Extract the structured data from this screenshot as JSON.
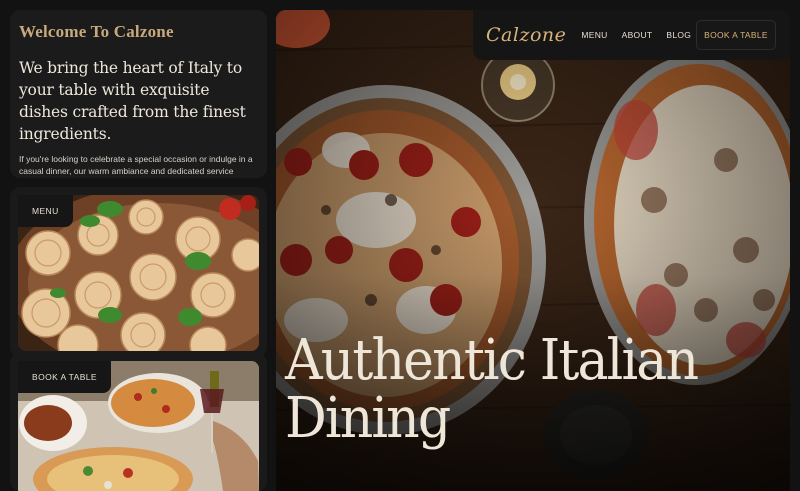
{
  "intro": {
    "welcome": "Welcome To Calzone",
    "lead": "We bring the heart of Italy to your table with exquisite dishes crafted from the finest ingredients.",
    "body": "If you're looking to celebrate a special occasion or indulge in a casual dinner, our warm ambiance and dedicated service ensure an unforgettable dining experience."
  },
  "cards": {
    "menu_label": "MENU",
    "book_label": "BOOK A TABLE"
  },
  "nav": {
    "logo": "Calzone",
    "links": [
      "MENU",
      "ABOUT",
      "BLOG"
    ],
    "cta": "BOOK A TABLE"
  },
  "hero": {
    "title_line1": "Authentic Italian",
    "title_line2": "Dining"
  },
  "colors": {
    "background": "#121212",
    "card": "#1b1b1b",
    "accent_gold": "#c8a97e",
    "text_light": "#eee7da"
  },
  "images": {
    "menu": "pasta-nests-with-basil",
    "book": "table-with-pizza-and-wine",
    "hero": "two-pizzas-on-wooden-table"
  }
}
